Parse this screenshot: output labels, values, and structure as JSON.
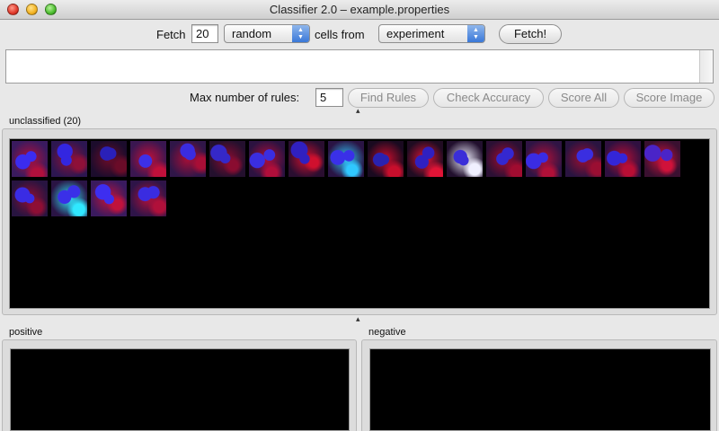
{
  "window": {
    "title": "Classifier 2.0 – example.properties"
  },
  "fetch": {
    "fetch_label": "Fetch",
    "count": "20",
    "mode_selected": "random",
    "cells_from_label": "cells  from",
    "source_selected": "experiment",
    "fetch_button": "Fetch!"
  },
  "rules": {
    "max_rules_label": "Max number of rules:",
    "max_rules_value": "5",
    "find_rules": "Find Rules",
    "check_accuracy": "Check Accuracy",
    "score_all": "Score All",
    "score_image": "Score Image"
  },
  "bins": {
    "unclassified_label": "unclassified (20)",
    "positive_label": "positive",
    "negative_label": "negative"
  },
  "tiles": [
    {
      "bg": "#3a1a5e",
      "nuc": "#3b2cf0",
      "mem": "#b0103c"
    },
    {
      "bg": "#2d1650",
      "nuc": "#3326e0",
      "mem": "#8e1038"
    },
    {
      "bg": "#1c0c2c",
      "nuc": "#2a20b8",
      "mem": "#6a0c28"
    },
    {
      "bg": "#3a1650",
      "nuc": "#3d30e8",
      "mem": "#c0103a"
    },
    {
      "bg": "#301648",
      "nuc": "#3a2ce0",
      "mem": "#a80e36"
    },
    {
      "bg": "#24102e",
      "nuc": "#3528c8",
      "mem": "#8a0c30"
    },
    {
      "bg": "#2c1240",
      "nuc": "#3a2ee0",
      "mem": "#b00e3a"
    },
    {
      "bg": "#2a0e30",
      "nuc": "#3020c0",
      "mem": "#d0102e"
    },
    {
      "bg": "#2a1444",
      "nuc": "#3a30e8",
      "mem": "#30c8ff"
    },
    {
      "bg": "#1a0a20",
      "nuc": "#2a22b0",
      "mem": "#c80e2c"
    },
    {
      "bg": "#200c22",
      "nuc": "#3020c0",
      "mem": "#e01436"
    },
    {
      "bg": "#22102e",
      "nuc": "#3a2ed8",
      "mem": "#f0f0ff"
    },
    {
      "bg": "#2c1034",
      "nuc": "#3428d0",
      "mem": "#a00c30"
    },
    {
      "bg": "#301444",
      "nuc": "#3a2ce4",
      "mem": "#b01038"
    },
    {
      "bg": "#2a1440",
      "nuc": "#3a2ee0",
      "mem": "#9a0e32"
    },
    {
      "bg": "#301040",
      "nuc": "#3426d8",
      "mem": "#b80e34"
    },
    {
      "bg": "#3a1030",
      "nuc": "#4a24c8",
      "mem": "#d0123a"
    },
    {
      "bg": "#281440",
      "nuc": "#3a2ce4",
      "mem": "#8e0e34"
    },
    {
      "bg": "#2a1444",
      "nuc": "#3a30e8",
      "mem": "#30e8ff"
    },
    {
      "bg": "#3a1a5e",
      "nuc": "#3d2ef0",
      "mem": "#c0123c"
    },
    {
      "bg": "#2e1448",
      "nuc": "#3a2ce0",
      "mem": "#b0103a"
    }
  ]
}
